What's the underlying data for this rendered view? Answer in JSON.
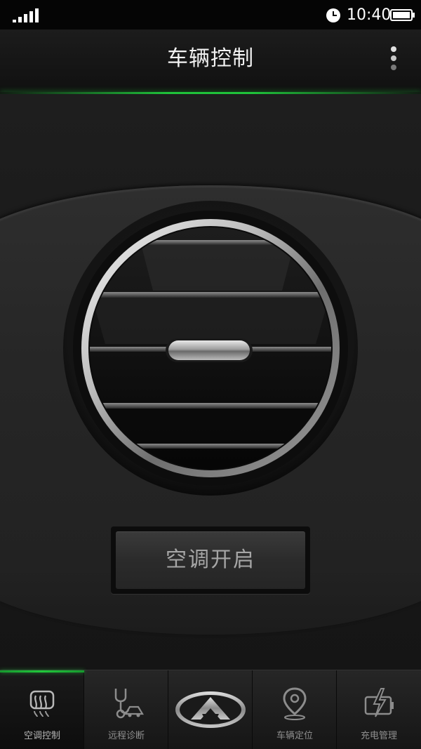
{
  "status_bar": {
    "time": "10:40",
    "signal_bars": 4,
    "battery_level": 1.0
  },
  "header": {
    "title": "车辆控制",
    "menu_icon": "more-vertical-icon"
  },
  "ac_control": {
    "toggle_label": "空调开启"
  },
  "bottom_nav": {
    "active_index": 0,
    "items": [
      {
        "label": "空调控制",
        "icon": "air-vent-icon"
      },
      {
        "label": "远程诊断",
        "icon": "stethoscope-car-icon"
      },
      {
        "label": "",
        "icon": "brand-logo-icon"
      },
      {
        "label": "车辆定位",
        "icon": "location-pin-icon"
      },
      {
        "label": "充电管理",
        "icon": "battery-charging-icon"
      }
    ]
  },
  "colors": {
    "accent_green": "#1fc23a",
    "background": "#1b1b1b",
    "text_primary": "#f2f2f2",
    "text_muted": "#8f8f8f"
  }
}
